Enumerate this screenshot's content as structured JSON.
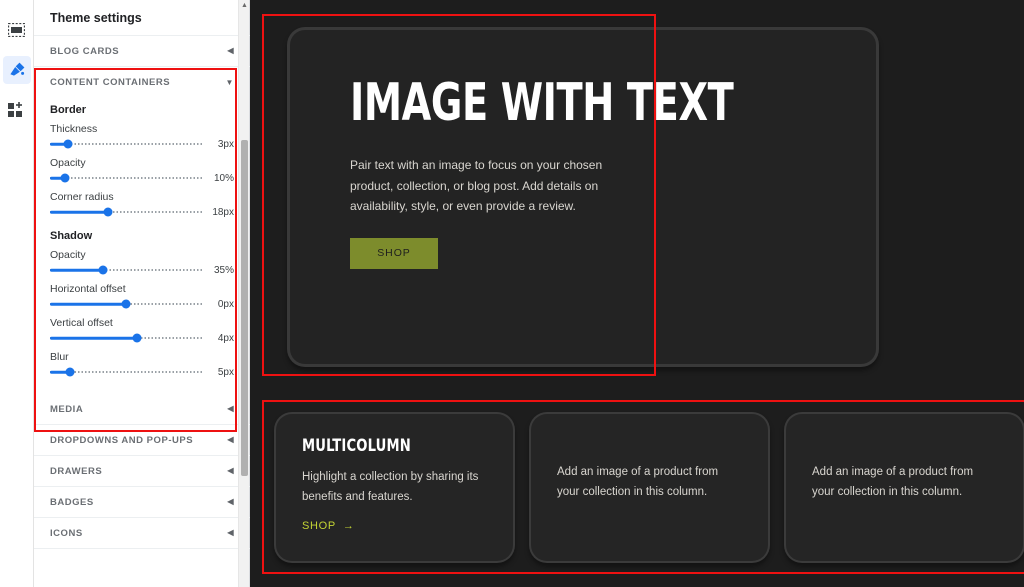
{
  "rail": {
    "items": [
      {
        "icon": "sections-icon",
        "label": "Sections",
        "active": false
      },
      {
        "icon": "theme-brush-icon",
        "label": "Theme settings",
        "active": true
      },
      {
        "icon": "add-blocks-icon",
        "label": "Add blocks",
        "active": false
      }
    ]
  },
  "panel": {
    "title": "Theme settings",
    "sections": [
      {
        "label": "BLOG CARDS",
        "expanded": false,
        "chevron": "chevron-left"
      },
      {
        "label": "CONTENT CONTAINERS",
        "expanded": true,
        "chevron": "chevron-down"
      }
    ],
    "content_containers": {
      "groups": [
        {
          "heading": "Border",
          "fields": [
            {
              "label": "Thickness",
              "value": "3px",
              "percent": 12
            },
            {
              "label": "Opacity",
              "value": "10%",
              "percent": 10
            },
            {
              "label": "Corner radius",
              "value": "18px",
              "percent": 38
            }
          ]
        },
        {
          "heading": "Shadow",
          "fields": [
            {
              "label": "Opacity",
              "value": "35%",
              "percent": 35
            },
            {
              "label": "Horizontal offset",
              "value": "0px",
              "percent": 50
            },
            {
              "label": "Vertical offset",
              "value": "4px",
              "percent": 57
            },
            {
              "label": "Blur",
              "value": "5px",
              "percent": 13
            }
          ]
        }
      ]
    },
    "more_sections": [
      {
        "label": "MEDIA",
        "chevron": "chevron-left"
      },
      {
        "label": "DROPDOWNS AND POP-UPS",
        "chevron": "chevron-left"
      },
      {
        "label": "DRAWERS",
        "chevron": "chevron-left"
      },
      {
        "label": "BADGES",
        "chevron": "chevron-left"
      },
      {
        "label": "ICONS",
        "chevron": "chevron-left"
      }
    ],
    "scrollbar": {
      "up_arrow": "▲"
    }
  },
  "preview": {
    "hero": {
      "title": "IMAGE WITH TEXT",
      "body": "Pair text with an image to focus on your chosen product, collection, or blog post. Add details on availability, style, or even provide a review.",
      "button_label": "SHOP",
      "button_color": "#7d8c2c",
      "image_placeholder": "image-placeholder-icon"
    },
    "multicolumn": {
      "cards": [
        {
          "title": "MULTICOLUMN",
          "body": "Highlight a collection by sharing its benefits and features.",
          "link_label": "SHOP",
          "link_arrow": "→",
          "link_color": "#c3d434"
        },
        {
          "title": "",
          "body": "Add an image of a product from your collection in this column."
        },
        {
          "title": "",
          "body": "Add an image of a product from your collection in this column."
        }
      ]
    }
  },
  "annotations": {
    "color": "#ee1111",
    "boxes": [
      {
        "name": "content-containers-highlight"
      },
      {
        "name": "image-with-text-section-highlight"
      },
      {
        "name": "multicolumn-section-highlight"
      }
    ]
  }
}
